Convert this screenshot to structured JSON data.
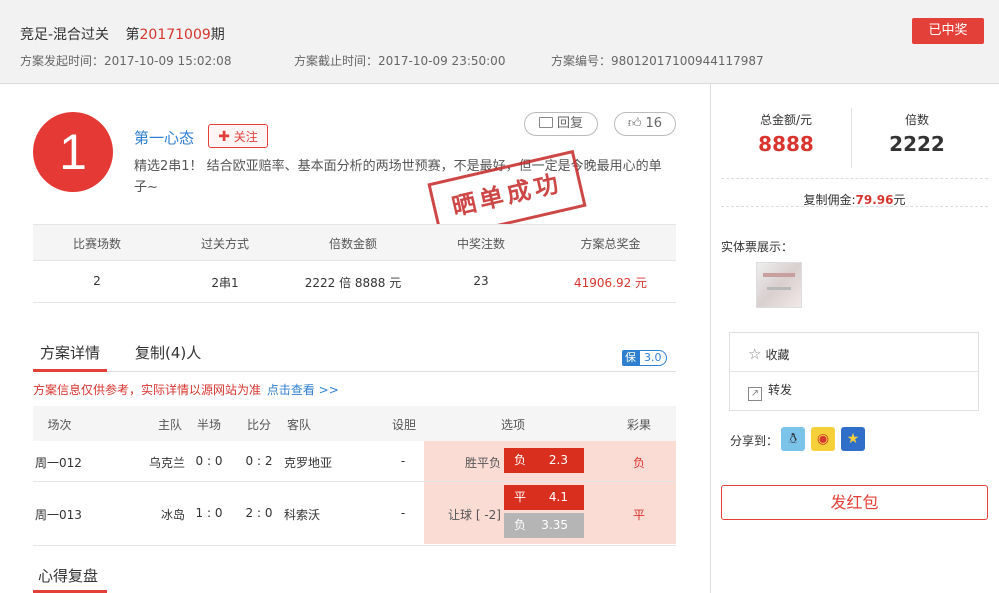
{
  "header": {
    "title": "竞足-混合过关",
    "issue_prefix": "第",
    "issue_no": "20171009",
    "issue_suffix": "期",
    "status_button": "已中奖",
    "start_time": "方案发起时间：2017-10-09 15:02:08",
    "end_time": "方案截止时间：2017-10-09 23:50:00",
    "plan_id": "方案编号：98012017100944117987"
  },
  "user": {
    "rank": "1",
    "name": "第一心态",
    "follow_label": "关注",
    "reply_label": "回复",
    "like_count": "16",
    "description": "精选2串1！ 结合欧亚赔率、基本面分析的两场世预赛，不是最好，但一定是今晚最用心的单子~",
    "stamp": "晒单成功"
  },
  "summary_table": {
    "headers": [
      "比赛场数",
      "过关方式",
      "倍数金额",
      "中奖注数",
      "方案总奖金"
    ],
    "row": [
      "2",
      "2串1",
      "2222 倍  8888 元",
      "23",
      "41906.92 元"
    ]
  },
  "tabs": {
    "detail": "方案详情",
    "copy": "复制(4)人",
    "badge_left": "保",
    "badge_right": "3.0"
  },
  "notice": {
    "text": "方案信息仅供参考，实际详情以源网站为准",
    "link": "点击查看 >>"
  },
  "match_table": {
    "headers": [
      "场次",
      "主队",
      "半场",
      "比分",
      "客队",
      "设胆",
      "选项",
      "彩果"
    ],
    "rows": [
      {
        "no": "周一012",
        "home": "乌克兰",
        "half": "0 : 0",
        "score": "0 : 2",
        "away": "克罗地亚",
        "banker": "-",
        "play": "胜平负",
        "options": [
          {
            "k": "负",
            "v": "2.3"
          }
        ],
        "result": "负"
      },
      {
        "no": "周一013",
        "home": "冰岛",
        "half": "1 : 0",
        "score": "2 : 0",
        "away": "科索沃",
        "banker": "-",
        "play": "让球 [ -2]",
        "options": [
          {
            "k": "平",
            "v": "4.1"
          },
          {
            "k": "负",
            "v": "3.35"
          }
        ],
        "result": "平"
      }
    ]
  },
  "review_heading": "心得复盘",
  "side": {
    "total_label": "总金额/元",
    "total_value": "8888",
    "mult_label": "倍数",
    "mult_value": "2222",
    "commission_label": "复制佣金:",
    "commission_value": "79.96",
    "commission_unit": "元",
    "ticket_label": "实体票展示：",
    "collect_label": "收藏",
    "forward_label": "转发",
    "share_label": "分享到：",
    "redpack_label": "发红包"
  },
  "colors": {
    "accent": "#e3403a",
    "link": "#2f7fd0"
  }
}
